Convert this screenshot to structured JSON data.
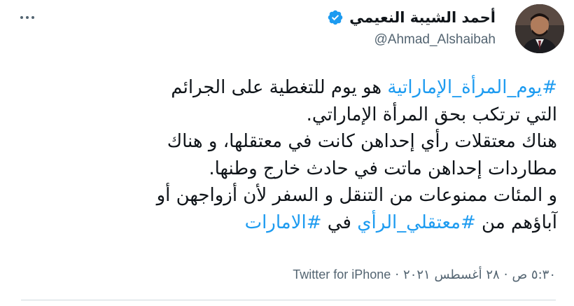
{
  "tweet": {
    "author": {
      "display_name": "أحمد الشيبة النعيمي",
      "handle": "@Ahmad_Alshaibah",
      "verified": true
    },
    "more_icon": "more-options-icon",
    "lines": [
      [
        {
          "text": "#يوم_المرأة_الإماراتية",
          "hashtag": true
        },
        {
          "text": " هو يوم للتغطية على الجرائم",
          "hashtag": false
        }
      ],
      [
        {
          "text": "التي ترتكب بحق المرأة الإماراتي.",
          "hashtag": false
        }
      ],
      [
        {
          "text": "هناك معتقلات رأي إحداهن كانت في معتقلها، و هناك",
          "hashtag": false
        }
      ],
      [
        {
          "text": "مطاردات إحداهن ماتت في حادث خارج وطنها.",
          "hashtag": false
        }
      ],
      [
        {
          "text": "و المئات ممنوعات من التنقل و السفر لأن أزواجهن أو",
          "hashtag": false
        }
      ],
      [
        {
          "text": "آباؤهم من ",
          "hashtag": false
        },
        {
          "text": "#معتقلي_الرأي",
          "hashtag": true
        },
        {
          "text": " في ",
          "hashtag": false
        },
        {
          "text": "#الامارات",
          "hashtag": true
        }
      ]
    ],
    "meta": {
      "time": "٥:٣٠ ص",
      "separator": "·",
      "date": "٢٨ أغسطس ٢٠٢١",
      "source": "Twitter for iPhone"
    },
    "colors": {
      "link": "#1d9bf0",
      "text": "#0f1419",
      "secondary": "#536471",
      "verified": "#1d9bf0"
    }
  }
}
